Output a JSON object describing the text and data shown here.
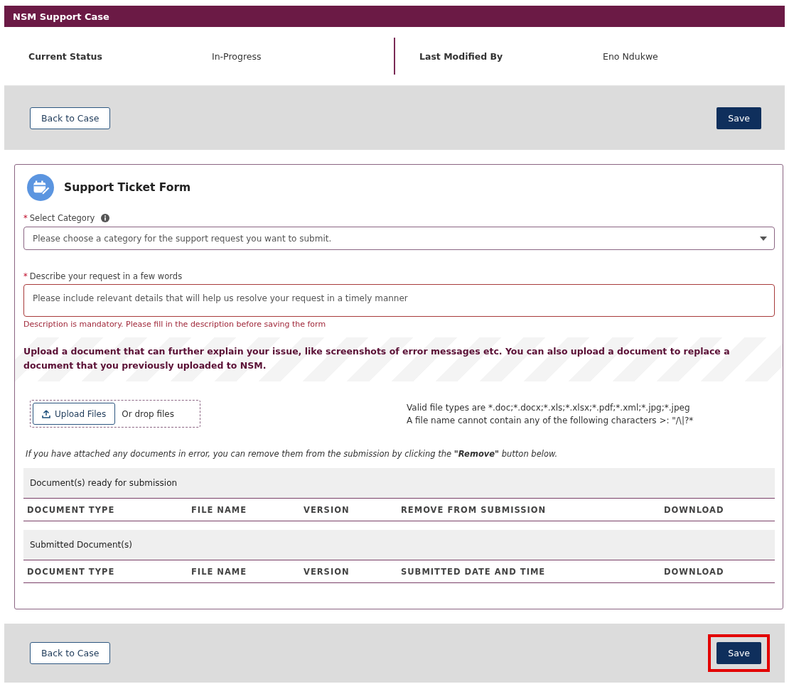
{
  "header": {
    "title": "NSM Support Case"
  },
  "status": [
    {
      "label": "Current Status",
      "value": "In-Progress"
    },
    {
      "label": "Last Modified By",
      "value": "Eno Ndukwe"
    }
  ],
  "top_actions": {
    "back": "Back to Case",
    "save": "Save",
    "save_highlighted": false
  },
  "form": {
    "title": "Support Ticket Form",
    "category": {
      "required_mark": "*",
      "label": "Select Category",
      "placeholder": "Please choose a category for the support request you want to submit."
    },
    "description": {
      "required_mark": "*",
      "label": "Describe your request in a few words",
      "placeholder": "Please include relevant details that will help us resolve your request in a timely manner",
      "error": "Description is mandatory. Please fill in the description before saving the form"
    },
    "upload_notice": "Upload a document that can further explain your issue, like screenshots of error messages etc. You can also upload a document to replace a document that you previously uploaded to NSM.",
    "upload_button": "Upload Files",
    "drop_hint": "Or drop files",
    "file_rules": [
      "Valid file types are *.doc;*.docx;*.xls;*.xlsx;*.pdf;*.xml;*.jpg;*.jpeg",
      "A file name cannot contain any of the following characters >: \"/\\|?*"
    ],
    "remove_note": "If you have attached any documents in error, you can remove them from the submission by clicking the **\"Remove\"** button below.",
    "tables": [
      {
        "title": "Document(s) ready for submission",
        "columns": [
          "DOCUMENT TYPE",
          "FILE NAME",
          "VERSION",
          "REMOVE FROM SUBMISSION",
          "DOWNLOAD"
        ]
      },
      {
        "title": "Submitted Document(s)",
        "columns": [
          "DOCUMENT TYPE",
          "FILE NAME",
          "VERSION",
          "SUBMITTED DATE AND TIME",
          "DOWNLOAD"
        ]
      }
    ]
  },
  "bottom_actions": {
    "back": "Back to Case",
    "save": "Save",
    "save_highlighted": true
  }
}
